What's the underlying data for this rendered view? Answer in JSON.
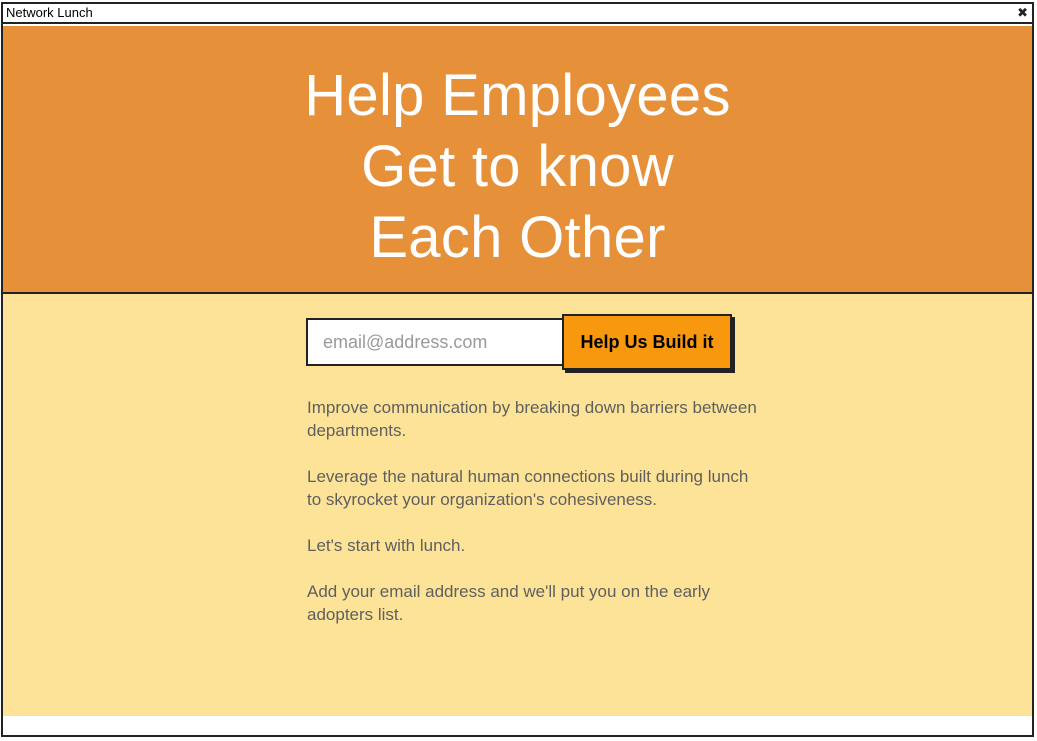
{
  "window": {
    "title": "Network Lunch",
    "close_icon": "puzzle-icon"
  },
  "hero": {
    "line1": "Help Employees",
    "line2": "Get to know",
    "line3": "Each Other"
  },
  "signup": {
    "email_placeholder": "email@address.com",
    "email_value": "",
    "button_label": "Help Us Build it"
  },
  "copy": {
    "p1": "Improve communication by breaking down barriers between departments.",
    "p2": "Leverage the natural human connections built during lunch to skyrocket your organization's cohesiveness.",
    "p3": "Let's start with lunch.",
    "p4": "Add your email address and we'll put you on the early adopters list."
  },
  "colors": {
    "hero_bg": "#e6913a",
    "content_bg": "#fde398",
    "button_bg": "#f7980f"
  }
}
